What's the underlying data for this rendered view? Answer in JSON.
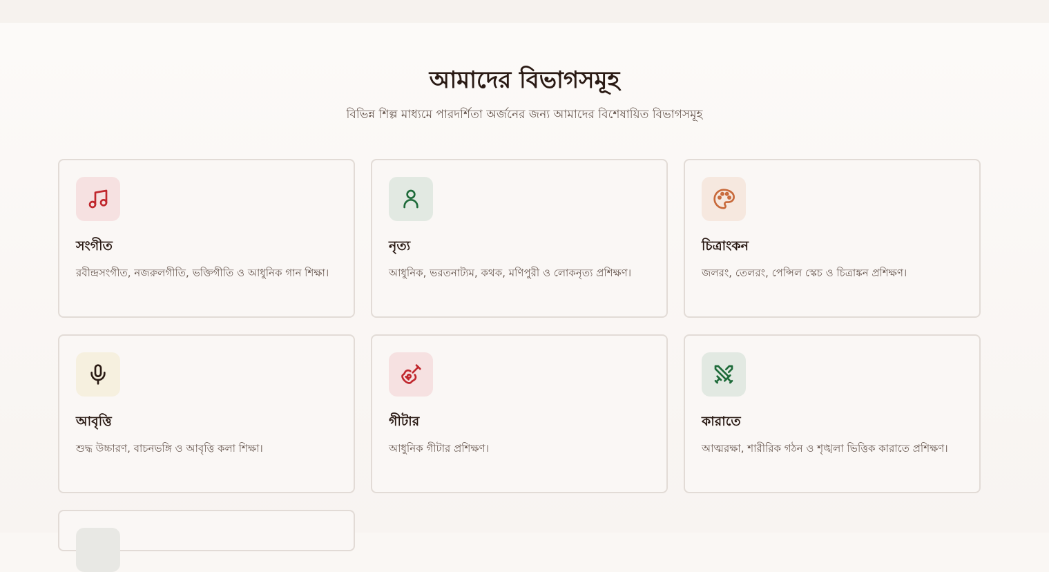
{
  "section": {
    "title": "আমাদের বিভাগসমূহ",
    "subtitle": "বিভিন্ন শিল্প মাধ্যমে পারদর্শিতা অর্জনের জন্য আমাদের বিশেষায়িত বিভাগসমূহ"
  },
  "departments": [
    {
      "title": "সংগীত",
      "description": "রবীন্দ্রসংগীত, নজরুলগীতি, ভক্তিগীতি ও আধুনিক গান শিক্ষা।",
      "icon": "music-note-icon",
      "icon_bg": "#f6e1e1",
      "icon_color": "#c0272d"
    },
    {
      "title": "নৃত্য",
      "description": "আধুনিক, ভরতনাট্যম, কথক, মণিপুরী ও লোকনৃত্য প্রশিক্ষণ।",
      "icon": "person-icon",
      "icon_bg": "#e2e9e2",
      "icon_color": "#1e6b3a"
    },
    {
      "title": "চিত্রাংকন",
      "description": "জলরং, তেলরং, পেন্সিল স্কেচ ও চিত্রাঙ্কন প্রশিক্ষণ।",
      "icon": "palette-icon",
      "icon_bg": "#f6e8df",
      "icon_color": "#c8693a"
    },
    {
      "title": "আবৃত্তি",
      "description": "শুদ্ধ উচ্চারণ, বাচনভঙ্গি ও আবৃত্তি কলা শিক্ষা।",
      "icon": "microphone-icon",
      "icon_bg": "#f6f0df",
      "icon_color": "#2a1a14"
    },
    {
      "title": "গীটার",
      "description": "আধুনিক গীটার প্রশিক্ষণ।",
      "icon": "guitar-icon",
      "icon_bg": "#f6e1e1",
      "icon_color": "#c0272d"
    },
    {
      "title": "কারাতে",
      "description": "আত্মরক্ষা, শারীরিক গঠন ও শৃঙ্খলা ভিত্তিক কারাতে প্রশিক্ষণ।",
      "icon": "crossed-swords-icon",
      "icon_bg": "#e2e9e2",
      "icon_color": "#1e6b3a"
    }
  ]
}
